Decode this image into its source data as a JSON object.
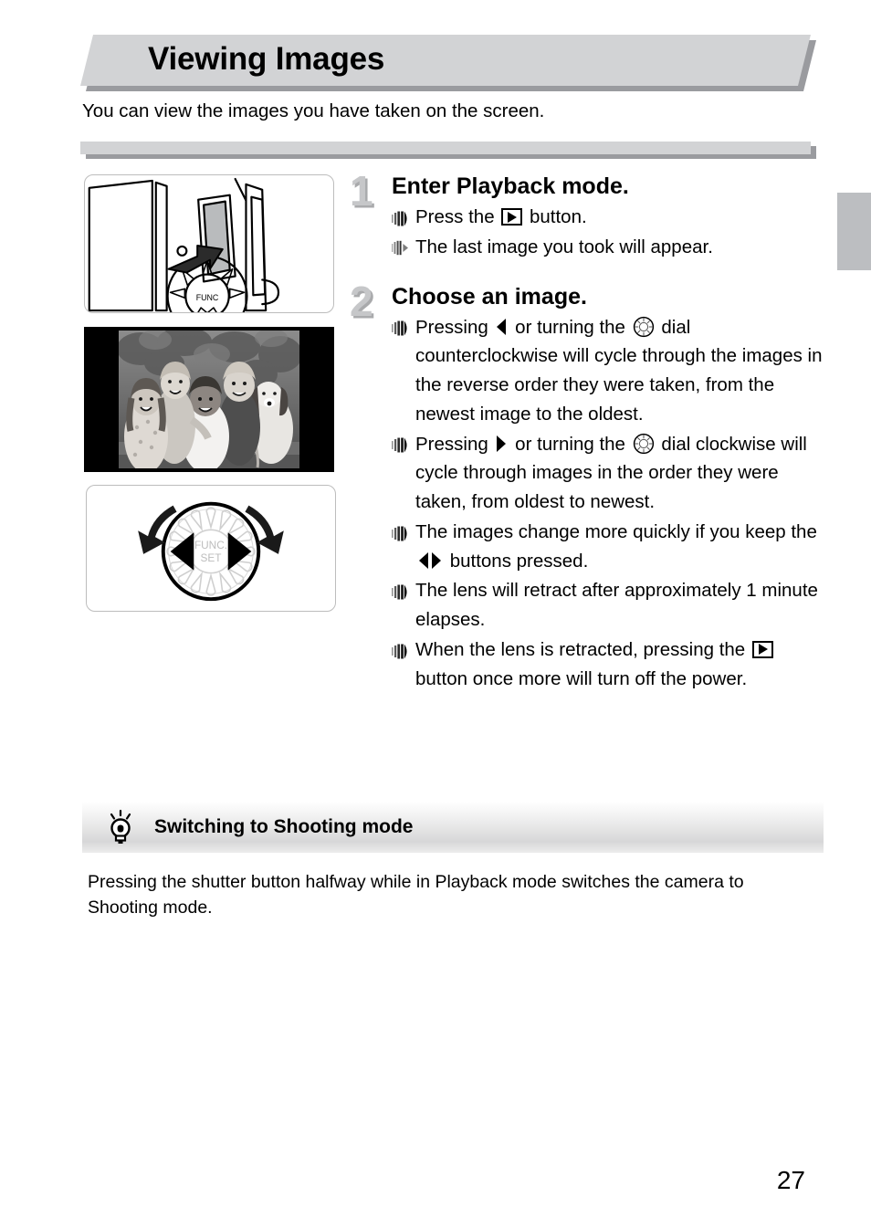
{
  "page": {
    "title": "Viewing Images",
    "intro": "You can view the images you have taken on the screen.",
    "number": "27"
  },
  "colors": {
    "banner_fill": "#d2d3d5",
    "banner_shadow": "#9a9b9f",
    "step_number": "#c6c7c9",
    "edge_tab": "#bcbec1",
    "text": "#000000"
  },
  "steps": [
    {
      "number": "1",
      "heading": "Enter Playback mode.",
      "bullets": [
        {
          "marker": "bars-icon",
          "parts": [
            {
              "type": "text",
              "value": "Press the "
            },
            {
              "type": "icon",
              "name": "playback-button-icon"
            },
            {
              "type": "text",
              "value": " button."
            }
          ]
        },
        {
          "marker": "bars-arrow-icon",
          "parts": [
            {
              "type": "text",
              "value": "The last image you took will appear."
            }
          ]
        }
      ]
    },
    {
      "number": "2",
      "heading": "Choose an image.",
      "bullets": [
        {
          "marker": "bars-icon",
          "parts": [
            {
              "type": "text",
              "value": "Pressing "
            },
            {
              "type": "icon",
              "name": "left-triangle-icon"
            },
            {
              "type": "text",
              "value": " or turning the "
            },
            {
              "type": "icon",
              "name": "control-dial-icon"
            },
            {
              "type": "text",
              "value": " dial counterclockwise will cycle through the images in the reverse order they were taken, from the newest image to the oldest."
            }
          ]
        },
        {
          "marker": "bars-icon",
          "parts": [
            {
              "type": "text",
              "value": "Pressing "
            },
            {
              "type": "icon",
              "name": "right-triangle-icon"
            },
            {
              "type": "text",
              "value": " or turning the "
            },
            {
              "type": "icon",
              "name": "control-dial-icon"
            },
            {
              "type": "text",
              "value": " dial clockwise will cycle through images in the order they were taken, from oldest to newest."
            }
          ]
        },
        {
          "marker": "bars-icon",
          "parts": [
            {
              "type": "text",
              "value": "The images change more quickly if you keep the "
            },
            {
              "type": "icon",
              "name": "left-right-triangles-icon"
            },
            {
              "type": "text",
              "value": " buttons pressed."
            }
          ]
        },
        {
          "marker": "bars-icon",
          "parts": [
            {
              "type": "text",
              "value": "The lens will retract after approximately 1 minute elapses."
            }
          ]
        },
        {
          "marker": "bars-icon",
          "parts": [
            {
              "type": "text",
              "value": "When the lens is retracted, pressing the "
            },
            {
              "type": "icon",
              "name": "playback-button-icon"
            },
            {
              "type": "text",
              "value": " button once more will turn off the power."
            }
          ]
        }
      ]
    }
  ],
  "figures": {
    "camera": {
      "name": "camera-back-playback-button-illustration"
    },
    "photo": {
      "name": "sample-photo-children-with-dog"
    },
    "dial": {
      "name": "control-dial-illustration",
      "center_label_line1": "FUNC.",
      "center_label_line2": "SET"
    }
  },
  "tip": {
    "icon": "lightbulb-icon",
    "title": "Switching to Shooting mode",
    "body": "Pressing the shutter button halfway while in Playback mode switches the camera to Shooting mode."
  }
}
